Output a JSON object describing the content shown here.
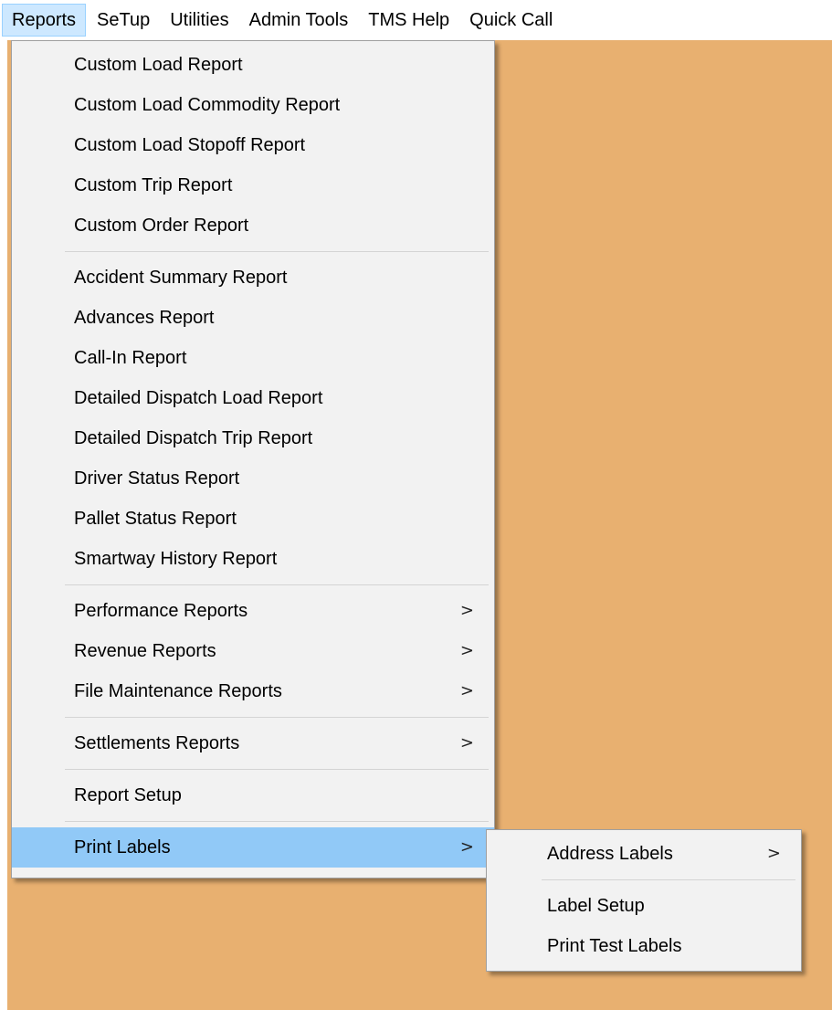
{
  "menubar": {
    "items": [
      {
        "label": "Reports",
        "active": true
      },
      {
        "label": "SeTup"
      },
      {
        "label": "Utilities"
      },
      {
        "label": "Admin Tools"
      },
      {
        "label": "TMS Help"
      },
      {
        "label": "Quick Call"
      }
    ]
  },
  "reports_menu": {
    "group1": [
      "Custom Load Report",
      "Custom Load Commodity Report",
      "Custom Load Stopoff Report",
      "Custom Trip Report",
      "Custom Order Report"
    ],
    "group2": [
      "Accident Summary Report",
      "Advances Report",
      "Call-In Report",
      "Detailed Dispatch Load Report",
      "Detailed Dispatch Trip Report",
      "Driver Status Report",
      "Pallet Status Report",
      "Smartway History Report"
    ],
    "group3": [
      "Performance Reports",
      "Revenue Reports",
      "File Maintenance Reports"
    ],
    "settlements": "Settlements Reports",
    "report_setup": "Report Setup",
    "print_labels": "Print Labels",
    "submenu_arrow": ">"
  },
  "print_labels_submenu": {
    "address_labels": "Address Labels",
    "label_setup": "Label Setup",
    "print_test_labels": "Print Test Labels"
  },
  "colors": {
    "desktop": "#e8b070",
    "menu_bg": "#f2f2f2",
    "highlight": "#91c9f7",
    "menubar_active": "#cde8ff"
  }
}
